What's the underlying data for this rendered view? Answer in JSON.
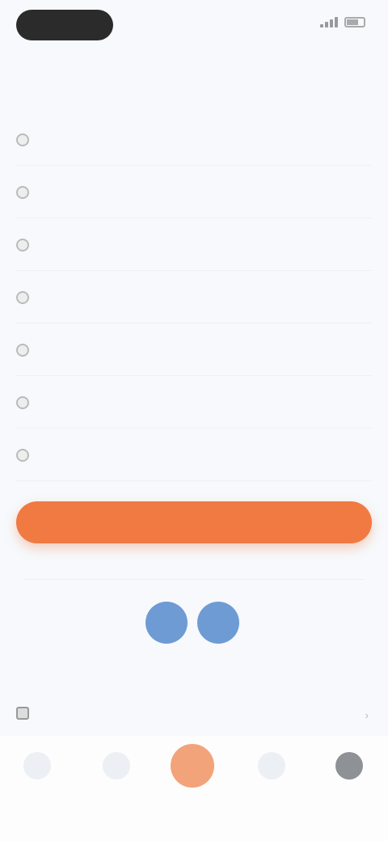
{
  "status": {
    "pill": "",
    "time": ""
  },
  "top": {
    "left_text": "",
    "center_text": ""
  },
  "section_title": "",
  "options": [
    {
      "label": ""
    },
    {
      "label": ""
    },
    {
      "label": ""
    },
    {
      "label": ""
    },
    {
      "label": ""
    },
    {
      "label": ""
    },
    {
      "label": ""
    }
  ],
  "primary_button": "",
  "helper_link": "",
  "social": {
    "caption": ""
  },
  "agreement": {
    "text": ""
  },
  "tabs": [
    {
      "label": ""
    },
    {
      "label": ""
    },
    {
      "label": ""
    },
    {
      "label": ""
    },
    {
      "label": ""
    }
  ],
  "colors": {
    "accent": "#f07a42",
    "link": "#6a93c8",
    "social": "#6e9bd4"
  }
}
